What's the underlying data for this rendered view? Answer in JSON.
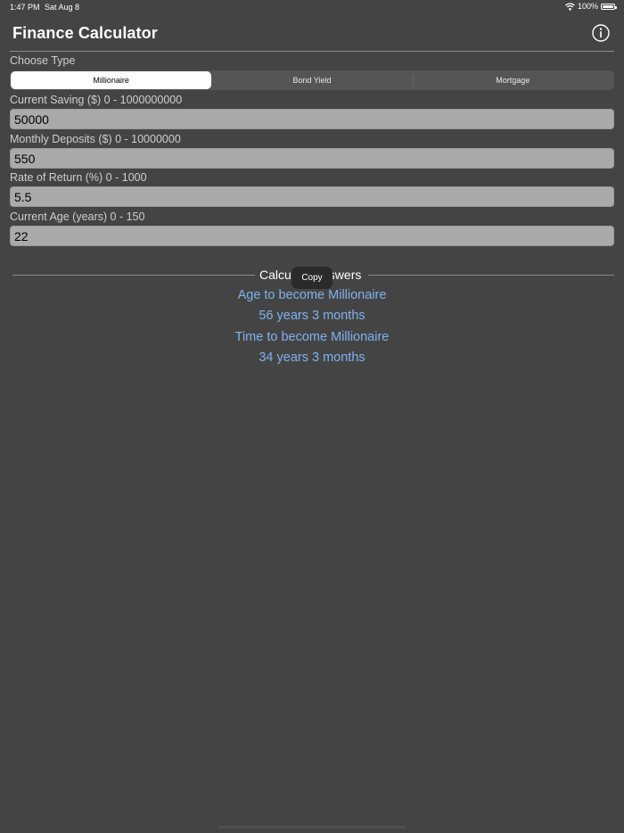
{
  "status_bar": {
    "time": "1:47 PM",
    "date": "Sat Aug 8",
    "battery": "100%",
    "wifi_icon": "wifi-icon",
    "battery_icon": "battery-icon"
  },
  "header": {
    "title": "Finance Calculator",
    "info_icon": "info-icon"
  },
  "type_selector": {
    "label": "Choose Type",
    "options": [
      "Millionaire",
      "Bond Yield",
      "Mortgage"
    ],
    "selected": "Millionaire"
  },
  "fields": [
    {
      "label": "Current Saving ($) 0 - 1000000000",
      "value": "50000"
    },
    {
      "label": "Monthly Deposits ($) 0 - 10000000",
      "value": "550"
    },
    {
      "label": "Rate of Return (%) 0 - 1000",
      "value": "5.5"
    },
    {
      "label": "Current Age (years) 0 - 150",
      "value": "22"
    }
  ],
  "results": {
    "title_left": "Calcu",
    "title_right": "swers",
    "copy_label": "Copy",
    "lines": [
      "Age to become Millionaire",
      "56 years 3 months",
      "Time to become Millionaire",
      "34 years 3 months"
    ]
  },
  "colors": {
    "background": "#444444",
    "input_background": "#aaaaaa",
    "result_text": "#7fb2ee"
  }
}
